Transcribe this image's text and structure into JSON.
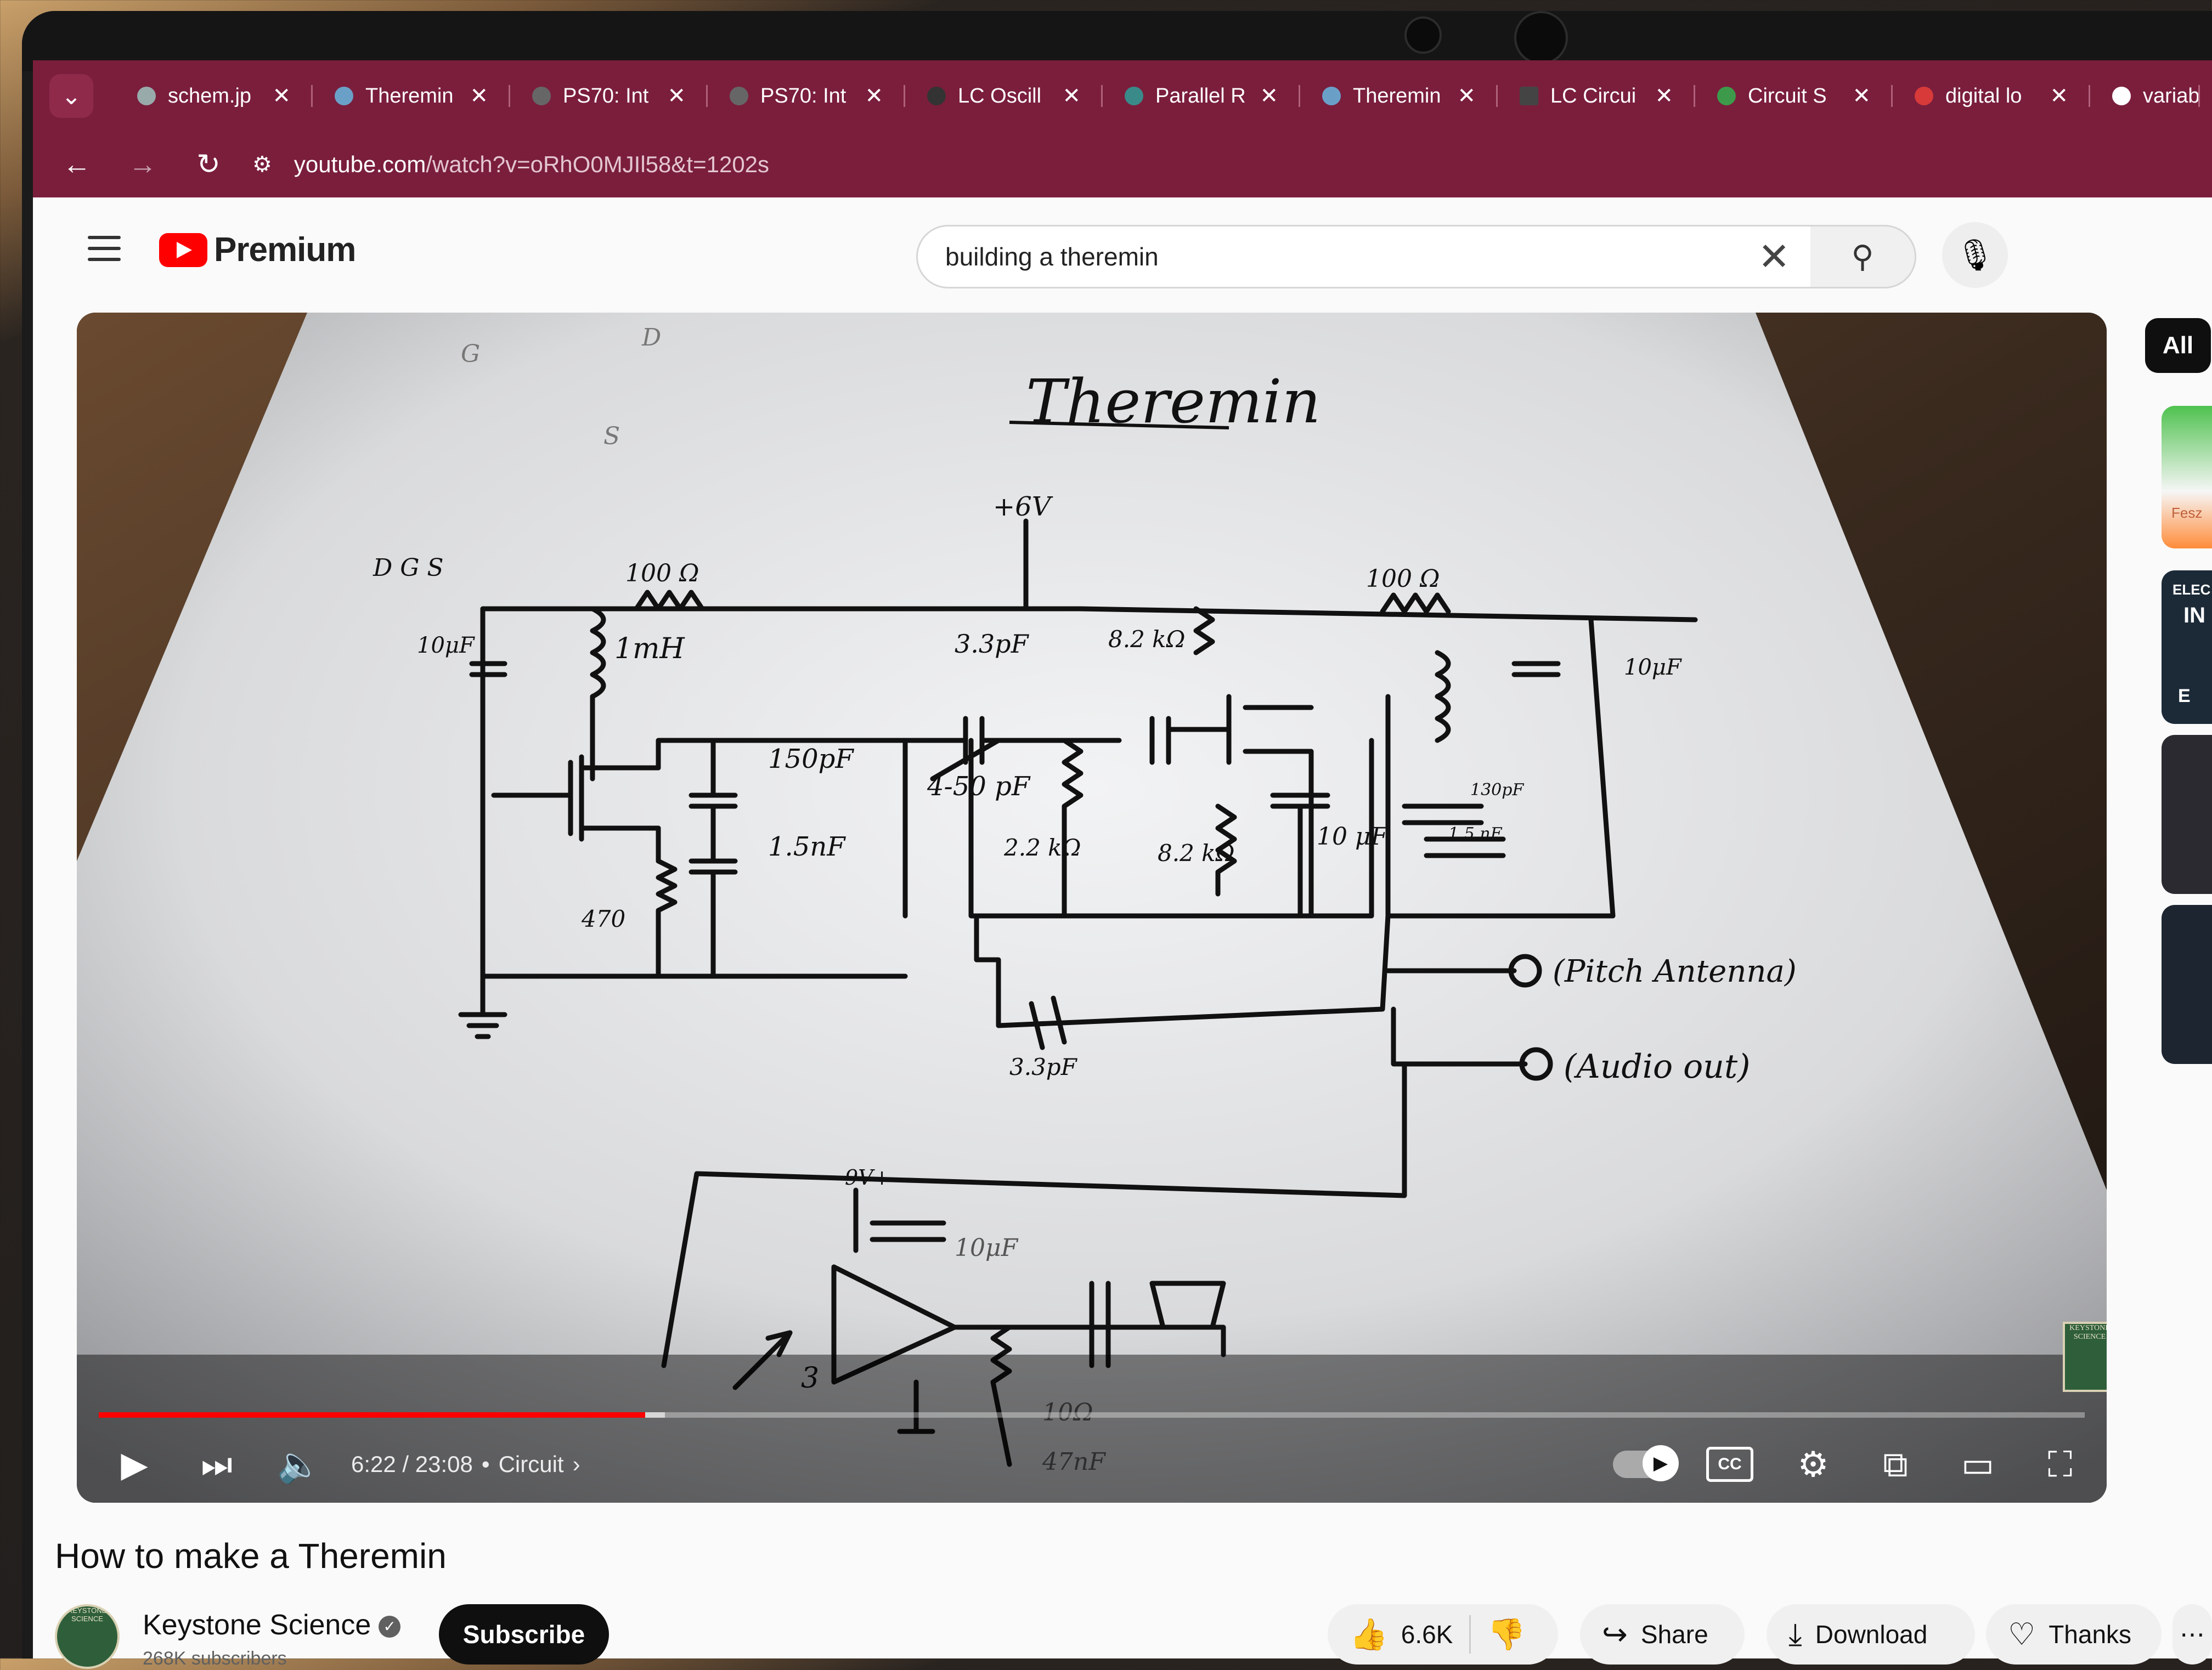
{
  "browser": {
    "tabs": [
      {
        "title": "schem.jp"
      },
      {
        "title": "Theremin"
      },
      {
        "title": "PS70: Int"
      },
      {
        "title": "PS70: Int"
      },
      {
        "title": "LC Oscill"
      },
      {
        "title": "Parallel R"
      },
      {
        "title": "Theremin"
      },
      {
        "title": "LC Circui"
      },
      {
        "title": "Circuit S"
      },
      {
        "title": "digital lo"
      },
      {
        "title": "variable"
      }
    ],
    "tab_close": "✕",
    "url_host": "youtube.com",
    "url_path": "/watch?v=oRhO0MJIl58&t=1202s"
  },
  "youtube": {
    "brand": "Premium",
    "search_query": "building a theremin",
    "chip_all": "All",
    "suggestion_labels": [
      "Fesz",
      "ELEC",
      "IN",
      "E"
    ],
    "player": {
      "time": "6:22 / 23:08",
      "chapter": "Circuit",
      "progress_played": 0.275,
      "progress_buffered": 0.285,
      "cc_label": "CC",
      "watermark": "KEYSTONE SCIENCE"
    },
    "video_title": "How to make a Theremin",
    "channel": {
      "name": "Keystone Science",
      "subscribers": "268K subscribers",
      "avatar_text": "KEYSTONE SCIENCE"
    },
    "subscribe_label": "Subscribe",
    "actions": {
      "likes": "6.6K",
      "share": "Share",
      "download": "Download",
      "thanks": "Thanks"
    }
  },
  "schematic": {
    "title": "Theremin",
    "labels": {
      "fet_g": "G",
      "fet_d": "D",
      "fet_s": "S",
      "pins": "D G S",
      "supply": "+6V",
      "r1": "100 Ω",
      "r2": "100 Ω",
      "c_in": "10μF",
      "l1": "1mH",
      "c_33": "3.3pF",
      "c_150": "150pF",
      "c_var": "4-50 pF",
      "c_15": "1.5nF",
      "r_22": "2.2 kΩ",
      "r_82a": "8.2 kΩ",
      "r_82b": "8.2 kΩ",
      "c_10": "10 μF",
      "c_10b": "10μF",
      "c_130": "130pF",
      "c_1n": "1.5 nF",
      "r_470": "470",
      "c_33b": "3.3pF",
      "pitch": "(Pitch Antenna)",
      "audio": "(Audio out)",
      "amp_v": "9V+",
      "amp_c": "10μF",
      "amp_pin": "3",
      "amp_r": "10Ω",
      "amp_c2": "47nF"
    }
  }
}
